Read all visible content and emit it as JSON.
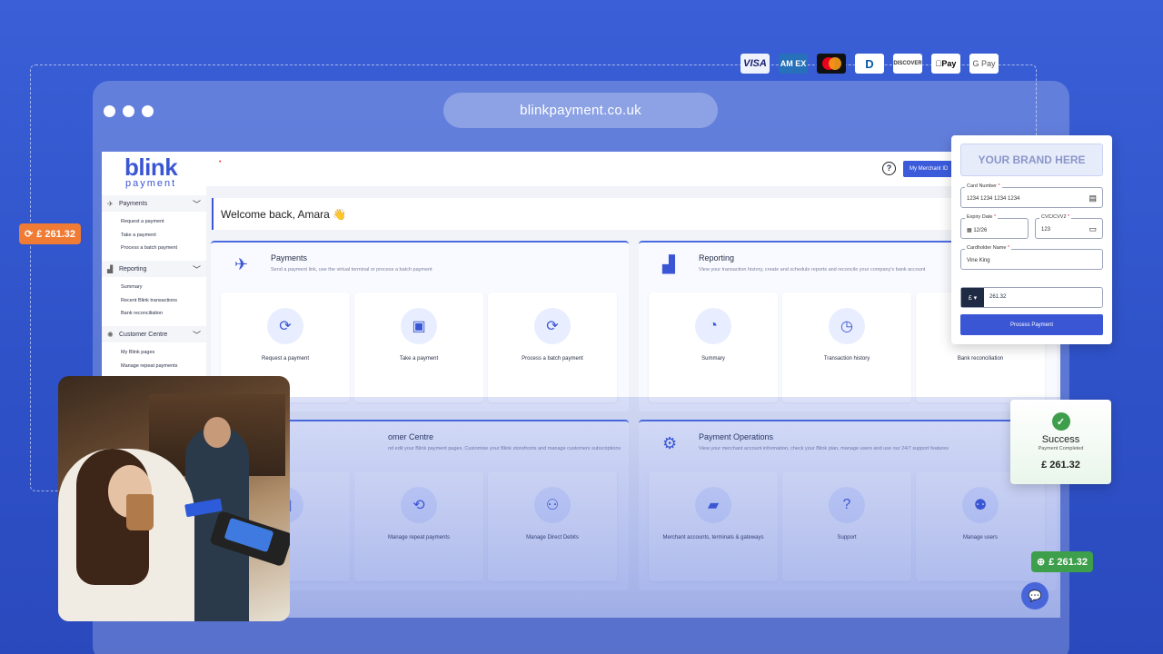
{
  "browser": {
    "url": "blinkpayment.co.uk"
  },
  "payment_methods": [
    "VISA",
    "AMEX",
    "Mastercard",
    "Diners Club",
    "DISCOVER",
    "Apple Pay",
    "G Pay"
  ],
  "payment_method_labels": {
    "visa": "VISA",
    "amex": "AM EX",
    "diners": "D",
    "discover": "DISCOVER",
    "apple": "Pay",
    "gpay": "G Pay"
  },
  "badges": {
    "orange": "£ 261.32",
    "green": "£ 261.32"
  },
  "app": {
    "brand": {
      "name": "blink",
      "sub": "payment"
    },
    "nav": [
      {
        "title": "Payments",
        "items": [
          "Request a payment",
          "Take a payment",
          "Process a batch payment"
        ]
      },
      {
        "title": "Reporting",
        "items": [
          "Summary",
          "Recent Blink transactions",
          "Bank reconciliation"
        ]
      },
      {
        "title": "Customer Centre",
        "items": [
          "My Blink pages",
          "Manage repeat payments"
        ]
      }
    ],
    "topbar": {
      "merchant_button": "My Merchant ID"
    },
    "welcome": "Welcome back, Amara 👋",
    "panels": [
      {
        "title": "Payments",
        "sub": "Send a payment link, use the virtual terminal or process a batch payment",
        "tiles": [
          "Request a payment",
          "Take a payment",
          "Process a batch payment"
        ]
      },
      {
        "title": "Reporting",
        "sub": "View your transaction history, create and schedule reports and reconcile your company's bank account",
        "tiles": [
          "Summary",
          "Transaction history",
          "Bank reconciliation"
        ]
      },
      {
        "title": "omer Centre",
        "sub": "nd edit your Blink payment pages. Customise your Blink storefronts and manage customers subscriptions",
        "tiles": [
          "ges",
          "Manage repeat payments",
          "Manage Direct Debits"
        ]
      },
      {
        "title": "Payment Operations",
        "sub": "View your merchant account information, check your Blink plan, manage users and use our 24/7 support features",
        "tiles": [
          "Merchant accounts, terminals & gateways",
          "Support",
          "Manage users"
        ]
      }
    ]
  },
  "payment_form": {
    "brand_placeholder": "YOUR BRAND HERE",
    "card_number": {
      "label": "Card Number",
      "value": "1234 1234 1234 1234"
    },
    "expiry": {
      "label": "Expiry Date",
      "value": "12/26"
    },
    "cvc": {
      "label": "CVC/CVV2",
      "value": "123"
    },
    "name": {
      "label": "Cardholder Name",
      "value": "Vine King"
    },
    "currency": "£ ▾",
    "amount": "261.32",
    "button": "Process Payment"
  },
  "success": {
    "title": "Success",
    "subtitle": "Payment Completed",
    "amount": "£ 261.32"
  }
}
